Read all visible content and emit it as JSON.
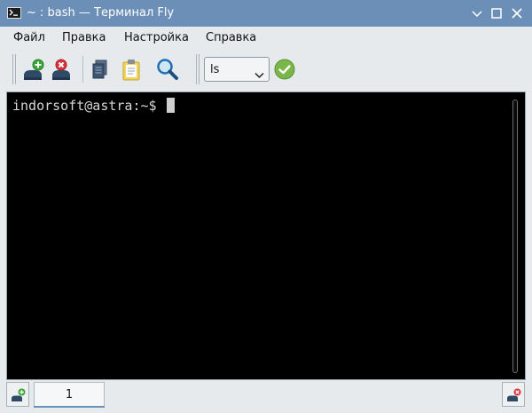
{
  "window": {
    "title": "~ : bash — Терминал Fly",
    "titlebar_color": "#6b8fb6"
  },
  "menu": {
    "items": [
      {
        "label": "Файл"
      },
      {
        "label": "Правка"
      },
      {
        "label": "Настройка"
      },
      {
        "label": "Справка"
      }
    ]
  },
  "toolbar": {
    "buttons": [
      {
        "icon": "new-session-icon"
      },
      {
        "icon": "close-session-icon"
      },
      {
        "icon": "copy-icon"
      },
      {
        "icon": "paste-icon"
      },
      {
        "icon": "search-icon"
      }
    ],
    "command_combo": {
      "value": "ls"
    },
    "run_icon": "checkmark-icon"
  },
  "terminal": {
    "prompt": "indorsoft@astra:~$ ",
    "background": "#000000",
    "foreground": "#d6d6d6"
  },
  "tabs": {
    "items": [
      {
        "label": "1"
      }
    ],
    "new_tab_icon": "new-tab-icon",
    "close_tab_icon": "close-tab-icon"
  }
}
